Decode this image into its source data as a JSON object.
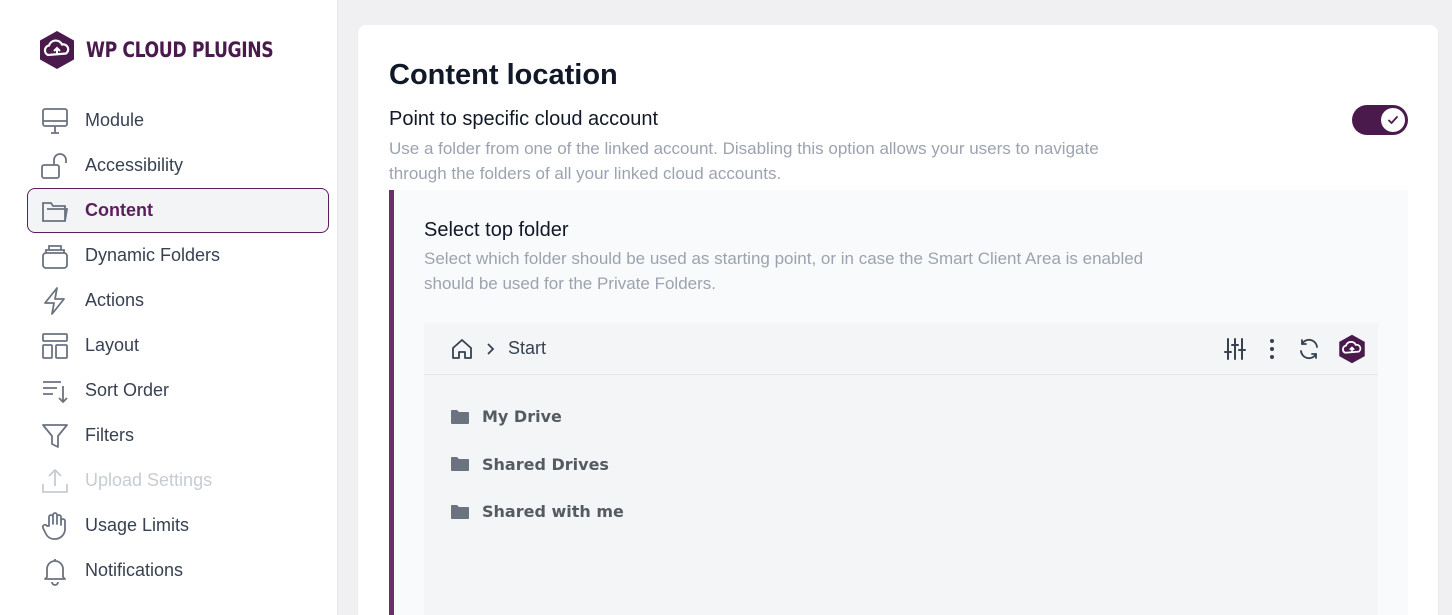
{
  "brand": {
    "name": "WP CLOUD PLUGINS",
    "color": "#4a1a4c"
  },
  "sidebar": {
    "items": [
      {
        "label": "Module",
        "icon": "monitor-icon",
        "state": "normal"
      },
      {
        "label": "Accessibility",
        "icon": "unlock-icon",
        "state": "normal"
      },
      {
        "label": "Content",
        "icon": "folder-open-icon",
        "state": "active"
      },
      {
        "label": "Dynamic Folders",
        "icon": "stack-icon",
        "state": "normal"
      },
      {
        "label": "Actions",
        "icon": "bolt-icon",
        "state": "normal"
      },
      {
        "label": "Layout",
        "icon": "layout-icon",
        "state": "normal"
      },
      {
        "label": "Sort Order",
        "icon": "sort-icon",
        "state": "normal"
      },
      {
        "label": "Filters",
        "icon": "filter-icon",
        "state": "normal"
      },
      {
        "label": "Upload Settings",
        "icon": "upload-icon",
        "state": "disabled"
      },
      {
        "label": "Usage Limits",
        "icon": "hand-icon",
        "state": "normal"
      },
      {
        "label": "Notifications",
        "icon": "bell-icon",
        "state": "normal"
      }
    ]
  },
  "main": {
    "title": "Content location",
    "option": {
      "title": "Point to specific cloud account",
      "description": "Use a folder from one of the linked account. Disabling this option allows your users to navigate through the folders of all your linked cloud accounts.",
      "enabled": true
    },
    "top_folder": {
      "title": "Select top folder",
      "description": "Select which folder should be used as starting point, or in case the Smart Client Area is enabled should be used for the Private Folders.",
      "breadcrumb": "Start",
      "folders": [
        "My Drive",
        "Shared Drives",
        "Shared with me"
      ]
    }
  }
}
